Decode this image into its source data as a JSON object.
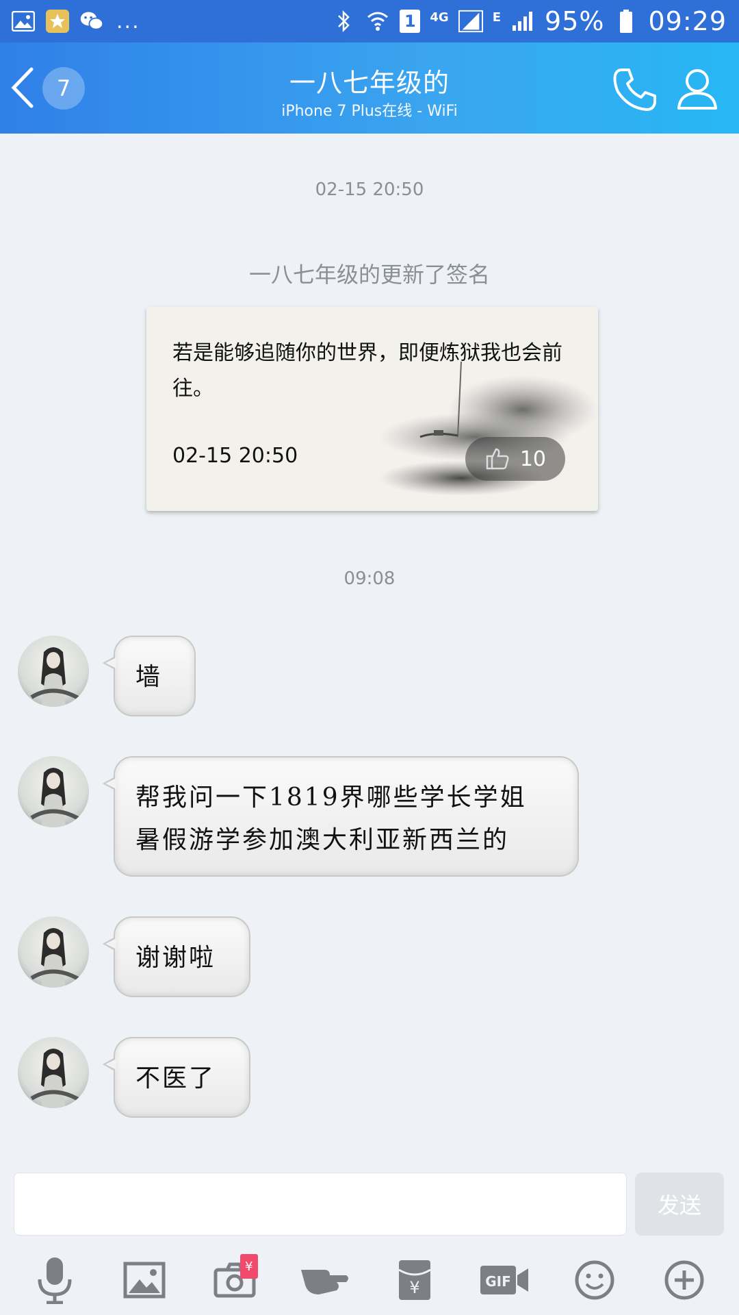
{
  "status_bar": {
    "lte_label": "4G",
    "sim_label": "1",
    "edge_label": "E",
    "battery": "95%",
    "time": "09:29",
    "more": "..."
  },
  "header": {
    "badge_count": "7",
    "title": "一八七年级的",
    "subtitle": "iPhone 7 Plus在线 - WiFi"
  },
  "chat": {
    "timestamp_1": "02-15 20:50",
    "system_note": "一八七年级的更新了签名",
    "signature_card": {
      "text": "若是能够追随你的世界，即便炼狱我也会前往。",
      "time": "02-15 20:50",
      "likes": "10"
    },
    "timestamp_2": "09:08",
    "messages": [
      {
        "text": "墙"
      },
      {
        "text_line1": "帮我问一下1819界哪些学长学姐",
        "text_line2": "暑假游学参加澳大利亚新西兰的"
      },
      {
        "text": "谢谢啦"
      },
      {
        "text": "不医了"
      }
    ]
  },
  "composer": {
    "input_value": "",
    "send_label": "发送"
  },
  "toolbar": {
    "items": [
      "mic-icon",
      "image-icon",
      "camera-icon",
      "poke-icon",
      "red-packet-icon",
      "gif-icon",
      "emoji-icon",
      "plus-icon"
    ],
    "camera_badge": "¥",
    "gif_label": "GIF",
    "red_packet_symbol": "¥"
  },
  "colors": {
    "status_bar": "#2f6fd8",
    "header_start": "#2f80e8",
    "header_end": "#27b7f4",
    "background": "#eef2f6",
    "muted_text": "#8a8f96",
    "send_disabled": "#dfe3e8",
    "badge_red": "#f24a6c"
  }
}
